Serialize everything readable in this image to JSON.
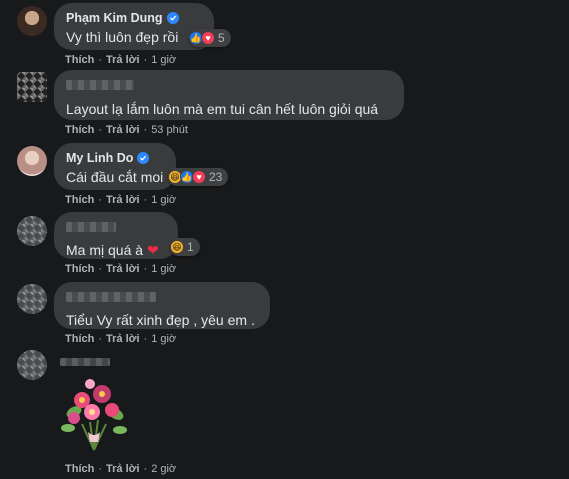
{
  "comments": [
    {
      "author": "Phạm Kim Dung",
      "verified": true,
      "text": "Vy thì luôn đẹp rồi",
      "reaction_count": "5",
      "reactions": [
        "like",
        "love"
      ],
      "actions": {
        "like": "Thích",
        "reply": "Trả lời",
        "time": "1 giờ"
      }
    },
    {
      "author": "",
      "verified": false,
      "text": "Layout lạ lắm luôn mà em tui cân hết luôn giỏi quá",
      "actions": {
        "like": "Thích",
        "reply": "Trả lời",
        "time": "53 phút"
      }
    },
    {
      "author": "My Linh Do",
      "verified": true,
      "text": "Cái đầu cắt moi",
      "reaction_count": "23",
      "reactions": [
        "haha",
        "like",
        "love"
      ],
      "actions": {
        "like": "Thích",
        "reply": "Trả lời",
        "time": "1 giờ"
      }
    },
    {
      "author": "",
      "verified": false,
      "text": "Ma mị quá à",
      "reaction_count": "1",
      "reactions": [
        "haha"
      ],
      "actions": {
        "like": "Thích",
        "reply": "Trả lời",
        "time": "1 giờ"
      }
    },
    {
      "author": "",
      "verified": false,
      "text": "Tiểu Vy rất xinh đẹp , yêu em .",
      "actions": {
        "like": "Thích",
        "reply": "Trả lời",
        "time": "1 giờ"
      }
    },
    {
      "author": "",
      "verified": false,
      "sticker": "flower-bouquet",
      "actions": {
        "like": "Thích",
        "reply": "Trả lời",
        "time": "2 giờ"
      }
    }
  ],
  "colors": {
    "background": "#18191a",
    "bubble": "#3a3b3c",
    "verified": "#2d88ff",
    "secondary_text": "#b0b3b8"
  }
}
